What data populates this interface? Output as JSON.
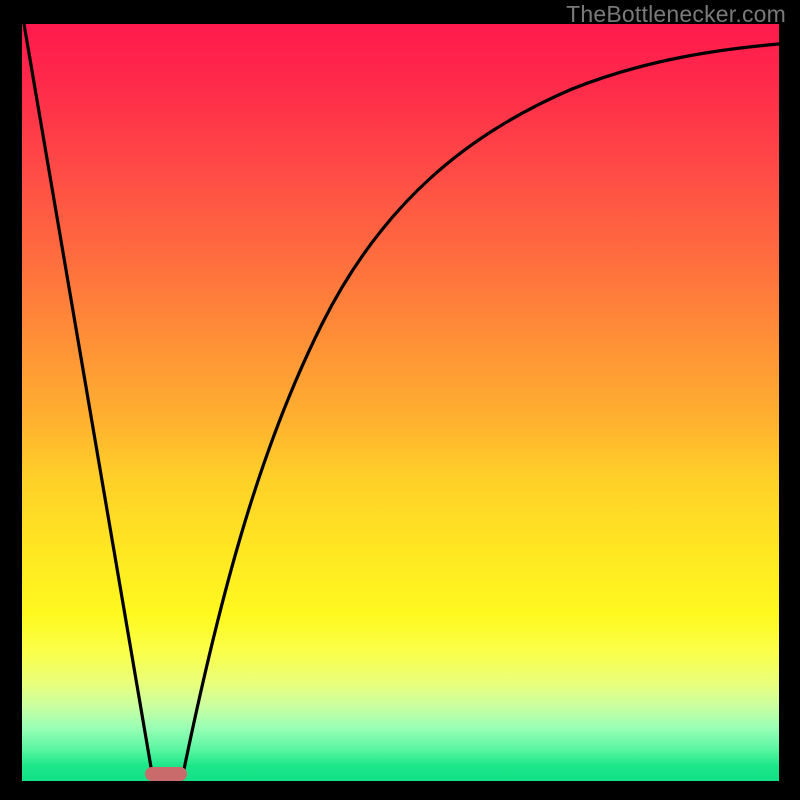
{
  "watermark": "TheBottlenecker.com",
  "chart_data": {
    "type": "line",
    "title": "",
    "xlabel": "",
    "ylabel": "",
    "ylim": [
      0,
      100
    ],
    "xlim": [
      0,
      100
    ],
    "background_gradient": [
      "#ff1a4d",
      "#ff8a38",
      "#ffe822",
      "#11e185"
    ],
    "marker": {
      "x_center_pct": 19,
      "width_pct": 5.5,
      "color": "#c96b6b"
    },
    "series": [
      {
        "name": "black-curve",
        "color": "#000000",
        "segments": [
          {
            "kind": "line",
            "points": [
              {
                "x": 0,
                "y": 100
              },
              {
                "x": 17,
                "y": 0
              }
            ]
          },
          {
            "kind": "curve",
            "points": [
              {
                "x": 21,
                "y": 0
              },
              {
                "x": 25,
                "y": 20
              },
              {
                "x": 30,
                "y": 40
              },
              {
                "x": 36,
                "y": 56
              },
              {
                "x": 44,
                "y": 70
              },
              {
                "x": 54,
                "y": 80
              },
              {
                "x": 66,
                "y": 87
              },
              {
                "x": 80,
                "y": 92
              },
              {
                "x": 100,
                "y": 97
              }
            ]
          }
        ]
      }
    ]
  }
}
